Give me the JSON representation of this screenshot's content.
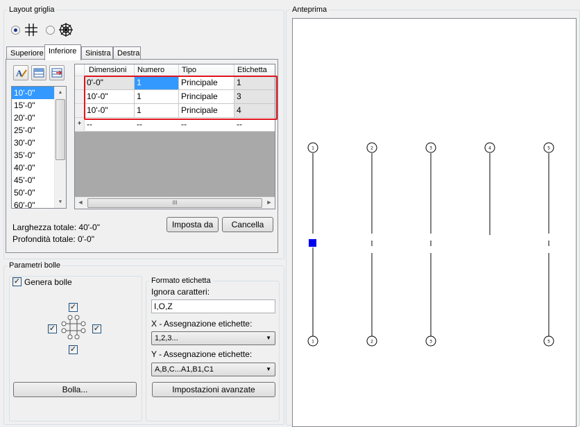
{
  "layout_group": {
    "title": "Layout griglia",
    "tabs": [
      "Superiore",
      "Inferiore",
      "Sinistra",
      "Destra"
    ],
    "active_tab": "Inferiore",
    "spacing_list": [
      "10'-0\"",
      "15'-0\"",
      "20'-0\"",
      "25'-0\"",
      "30'-0\"",
      "35'-0\"",
      "40'-0\"",
      "45'-0\"",
      "50'-0\"",
      "60'-0\""
    ],
    "selected_spacing": "10'-0\"",
    "grid": {
      "headers": [
        "Dimensioni",
        "Numero",
        "Tipo",
        "Etichetta"
      ],
      "rows": [
        {
          "dimensioni": "0'-0\"",
          "numero": "1",
          "tipo": "Principale",
          "etichetta": "1"
        },
        {
          "dimensioni": "10'-0\"",
          "numero": "1",
          "tipo": "Principale",
          "etichetta": "3"
        },
        {
          "dimensioni": "10'-0\"",
          "numero": "1",
          "tipo": "Principale",
          "etichetta": "4"
        }
      ],
      "new_row": {
        "marker": "+",
        "dimensioni": "--",
        "numero": "--",
        "tipo": "--",
        "etichetta": "--"
      },
      "hscroll_grip": "III"
    },
    "larghezza_totale": "Larghezza totale: 40'-0\"",
    "profondita_totale": "Profondità totale: 0'-0\"",
    "imposta_button": "Imposta da",
    "cancella_button": "Cancella"
  },
  "bolle_group": {
    "title": "Parametri bolle",
    "genera_bolle_label": "Genera bolle",
    "genera_bolle_checked": true,
    "bolla_button": "Bolla...",
    "formato": {
      "title": "Formato etichetta",
      "ignora_label": "Ignora caratteri:",
      "ignora_value": "I,O,Z",
      "x_label": "X - Assegnazione etichette:",
      "x_value": "1,2,3...",
      "y_label": "Y - Assegnazione etichette:",
      "y_value": "A,B,C...A1,B1,C1",
      "advanced_button": "Impostazioni avanzate"
    }
  },
  "preview": {
    "title": "Anteprima",
    "top_bubbles": [
      "1",
      "2",
      "3",
      "4",
      "5"
    ],
    "bottom_bubbles": [
      "1",
      "2",
      "3",
      "5"
    ]
  },
  "colors": {
    "selection": "#3399ff",
    "highlight_box": "#e0141e",
    "marker": "#0000ee"
  }
}
